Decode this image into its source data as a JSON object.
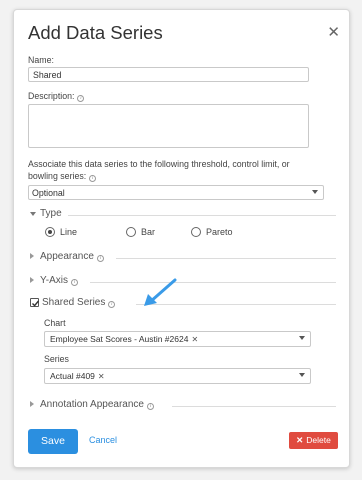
{
  "dialog": {
    "title": "Add Data Series",
    "close_icon": "close-icon"
  },
  "name": {
    "label": "Name:",
    "value": "Shared"
  },
  "description": {
    "label": "Description:",
    "value": ""
  },
  "associate": {
    "label_line1": "Associate this data series to the following threshold, control limit, or",
    "label_line2": "bowling series:",
    "selected": "Optional"
  },
  "type_section": {
    "title": "Type",
    "options": [
      "Line",
      "Bar",
      "Pareto"
    ],
    "selected": "Line"
  },
  "appearance_section": {
    "title": "Appearance"
  },
  "yaxis_section": {
    "title": "Y-Axis"
  },
  "shared_series_section": {
    "title": "Shared Series",
    "checked": true,
    "chart_label": "Chart",
    "chart_value": "Employee Sat Scores - Austin #2624",
    "series_label": "Series",
    "series_value": "Actual #409"
  },
  "annotation_section": {
    "title": "Annotation Appearance"
  },
  "footer": {
    "save_label": "Save",
    "cancel_label": "Cancel",
    "delete_label": "Delete"
  },
  "colors": {
    "primary": "#2b8fe0",
    "danger": "#e04b3f",
    "arrow": "#3a9be8"
  }
}
